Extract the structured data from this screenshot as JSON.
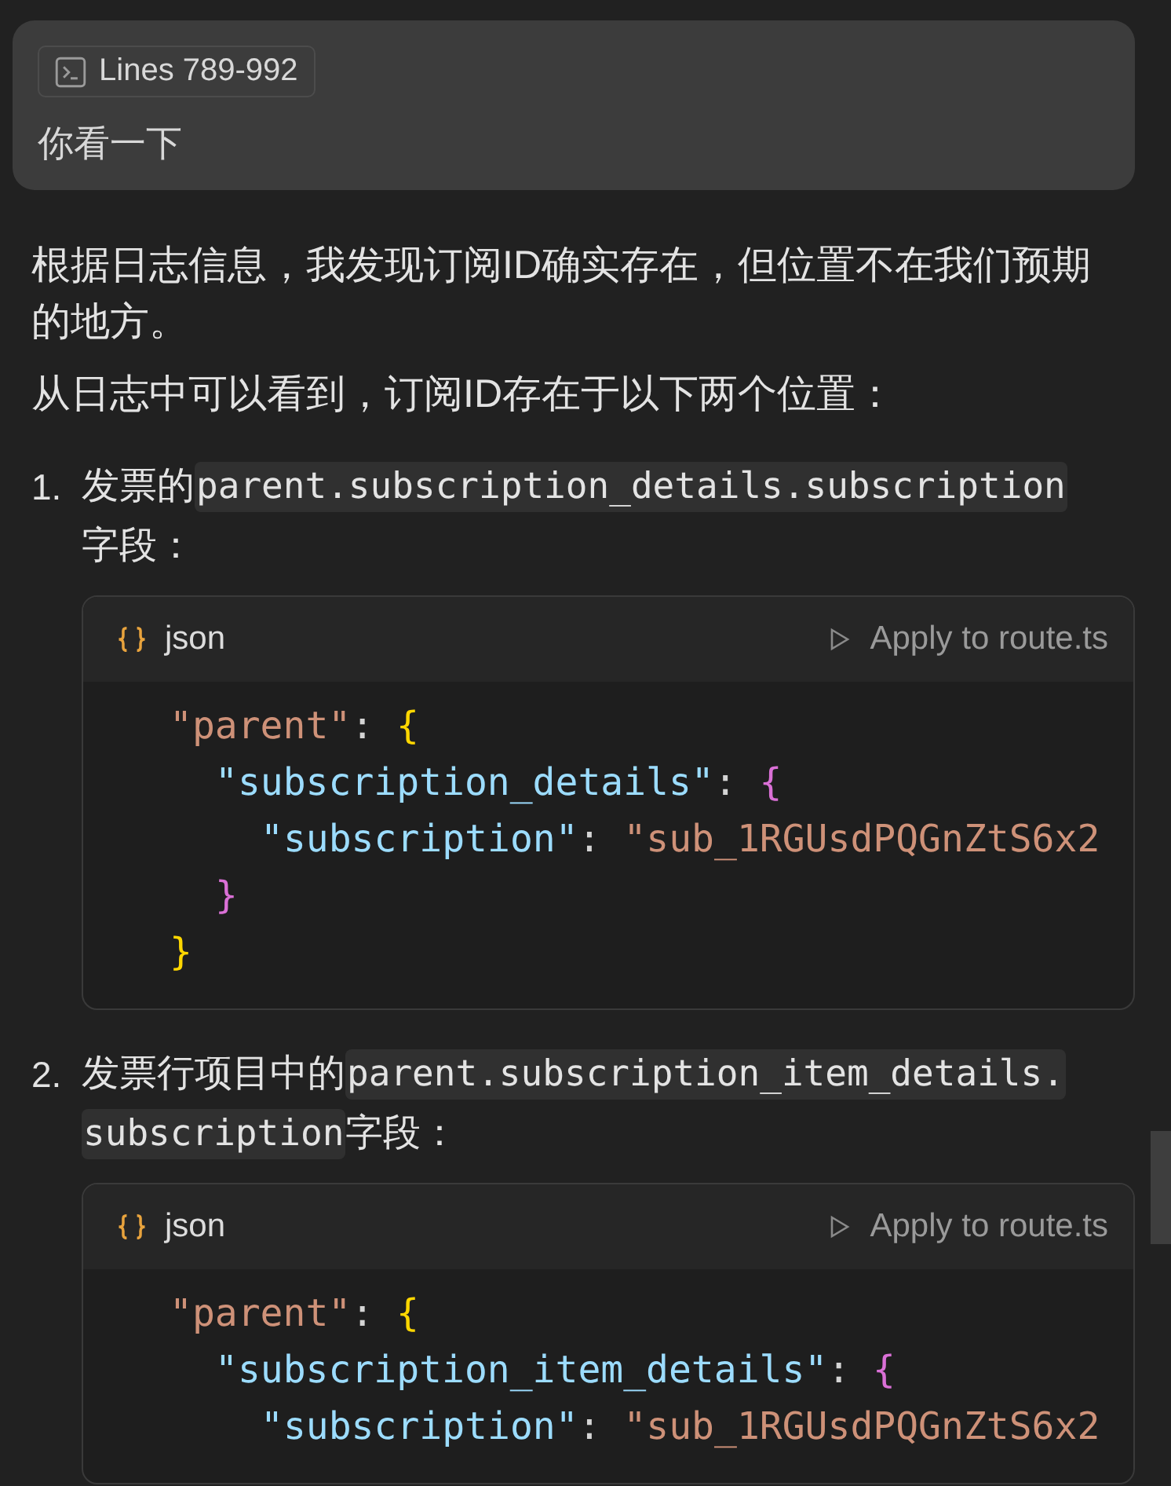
{
  "user_message": {
    "attachment": {
      "label": "Lines 789-992"
    },
    "text": "你看一下"
  },
  "reply": {
    "paragraphs": [
      "根据日志信息，我发现订阅ID确实存在，但位置不在我们预期的地方。",
      "从日志中可以看到，订阅ID存在于以下两个位置："
    ],
    "list": [
      {
        "number": "1.",
        "before": "发票的",
        "code": [
          "parent.subscription_details.subscription"
        ],
        "after": "字段：",
        "block": {
          "language": "json",
          "apply": "Apply to route.ts",
          "lines": [
            {
              "tokens": [
                {
                  "kind": "string",
                  "text": "\"parent\""
                },
                {
                  "kind": "punct",
                  "text": ": "
                },
                {
                  "kind": "brace1",
                  "text": "{"
                }
              ],
              "children": [
                {
                  "tokens": [
                    {
                      "kind": "key",
                      "text": "\"subscription_details\""
                    },
                    {
                      "kind": "punct",
                      "text": ": "
                    },
                    {
                      "kind": "brace2",
                      "text": "{"
                    }
                  ],
                  "children": [
                    {
                      "tokens": [
                        {
                          "kind": "key",
                          "text": "\"subscription\""
                        },
                        {
                          "kind": "punct",
                          "text": ": "
                        },
                        {
                          "kind": "string",
                          "text": "\"sub_1RGUsdPQGnZtS6x2"
                        }
                      ]
                    }
                  ]
                },
                {
                  "tokens": [
                    {
                      "kind": "brace2",
                      "text": "}"
                    }
                  ]
                }
              ]
            },
            {
              "tokens": [
                {
                  "kind": "brace1",
                  "text": "}"
                }
              ]
            }
          ]
        }
      },
      {
        "number": "2.",
        "before": "发票行项目中的",
        "code": [
          "parent.subscription_item_details.",
          "subscription"
        ],
        "after": "字段：",
        "block": {
          "language": "json",
          "apply": "Apply to route.ts",
          "lines": [
            {
              "tokens": [
                {
                  "kind": "string",
                  "text": "\"parent\""
                },
                {
                  "kind": "punct",
                  "text": ": "
                },
                {
                  "kind": "brace1",
                  "text": "{"
                }
              ],
              "children": [
                {
                  "tokens": [
                    {
                      "kind": "key",
                      "text": "\"subscription_item_details\""
                    },
                    {
                      "kind": "punct",
                      "text": ": "
                    },
                    {
                      "kind": "brace2",
                      "text": "{"
                    }
                  ],
                  "children": [
                    {
                      "tokens": [
                        {
                          "kind": "key",
                          "text": "\"subscription\""
                        },
                        {
                          "kind": "punct",
                          "text": ": "
                        },
                        {
                          "kind": "string",
                          "text": "\"sub_1RGUsdPQGnZtS6x2"
                        }
                      ]
                    }
                  ]
                }
              ]
            }
          ]
        }
      }
    ]
  }
}
